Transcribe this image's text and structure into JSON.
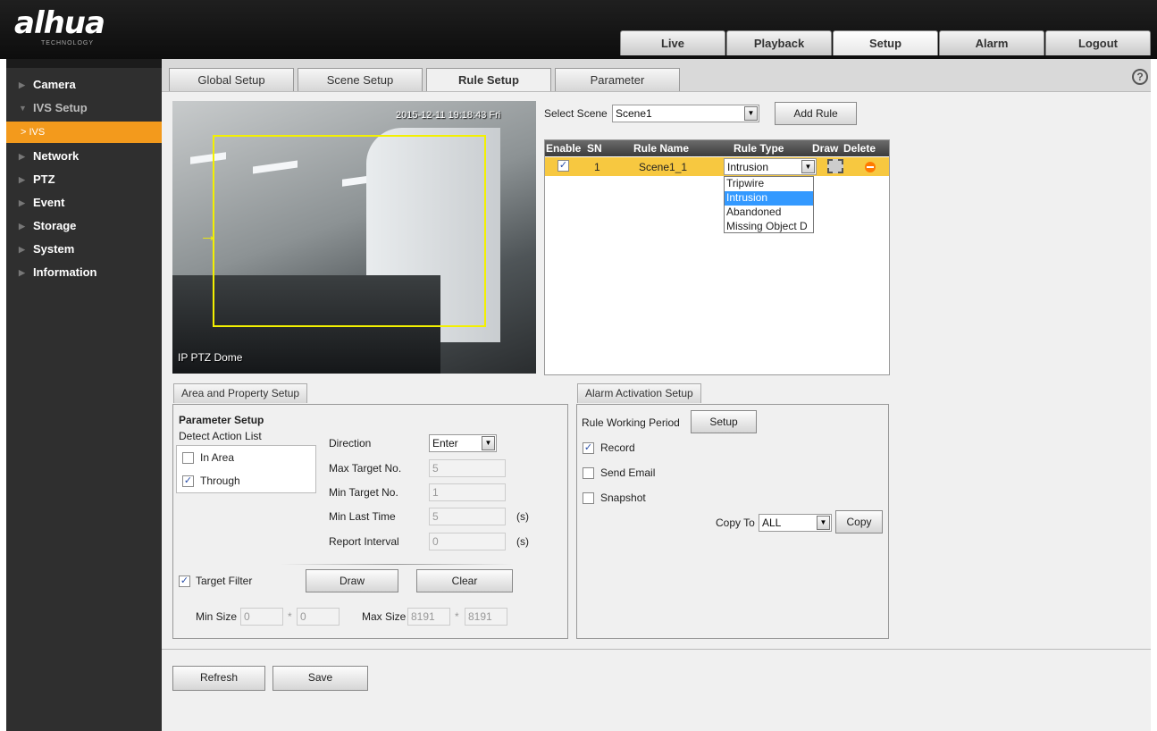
{
  "brand": {
    "logo": "alhua",
    "sub": "TECHNOLOGY"
  },
  "topnav": [
    "Live",
    "Playback",
    "Setup",
    "Alarm",
    "Logout"
  ],
  "menu": {
    "camera": "Camera",
    "ivs_setup": "IVS Setup",
    "ivs": "> IVS",
    "network": "Network",
    "ptz": "PTZ",
    "event": "Event",
    "storage": "Storage",
    "system": "System",
    "information": "Information"
  },
  "tabs": [
    "Global Setup",
    "Scene Setup",
    "Rule Setup",
    "Parameter"
  ],
  "video": {
    "timestamp": "2015-12-11 19:18:43 Fri",
    "camera_name": "IP PTZ Dome"
  },
  "scene": {
    "label": "Select Scene",
    "value": "Scene1",
    "add_rule": "Add Rule"
  },
  "rule_table": {
    "headers": [
      "Enable",
      "SN",
      "Rule Name",
      "Rule Type",
      "Draw",
      "Delete"
    ],
    "row": {
      "enabled": "✓",
      "sn": "1",
      "name": "Scene1_1",
      "type": "Intrusion"
    },
    "type_options": [
      "Tripwire",
      "Intrusion",
      "Abandoned",
      "Missing Object D"
    ]
  },
  "area": {
    "tab": "Area and Property Setup",
    "parameter_setup": "Parameter Setup",
    "detect_action_list": "Detect Action List",
    "actions": [
      {
        "label": "In Area",
        "checked": ""
      },
      {
        "label": "Through",
        "checked": "✓"
      }
    ],
    "direction_label": "Direction",
    "direction_value": "Enter",
    "max_target_label": "Max Target No.",
    "max_target_value": "5",
    "min_target_label": "Min Target No.",
    "min_target_value": "1",
    "min_last_label": "Min Last Time",
    "min_last_value": "5",
    "report_interval_label": "Report Interval",
    "report_interval_value": "0",
    "unit_s": "(s)",
    "target_filter_label": "Target Filter",
    "target_filter_checked": "✓",
    "draw": "Draw",
    "clear": "Clear",
    "min_size_label": "Min Size",
    "min_size_w": "0",
    "min_size_h": "0",
    "max_size_label": "Max Size",
    "max_size_w": "8191",
    "max_size_h": "8191",
    "times": "*"
  },
  "alarm": {
    "tab": "Alarm Activation Setup",
    "working_period": "Rule Working Period",
    "setup": "Setup",
    "record": "Record",
    "record_checked": "✓",
    "send_email": "Send Email",
    "snapshot": "Snapshot",
    "copy_to": "Copy To",
    "copy_value": "ALL",
    "copy": "Copy"
  },
  "footer": {
    "refresh": "Refresh",
    "save": "Save"
  },
  "colors": {
    "accent_orange": "#f39a1c",
    "row_highlight": "#f7c840",
    "rule_yellow": "#f3f000"
  }
}
